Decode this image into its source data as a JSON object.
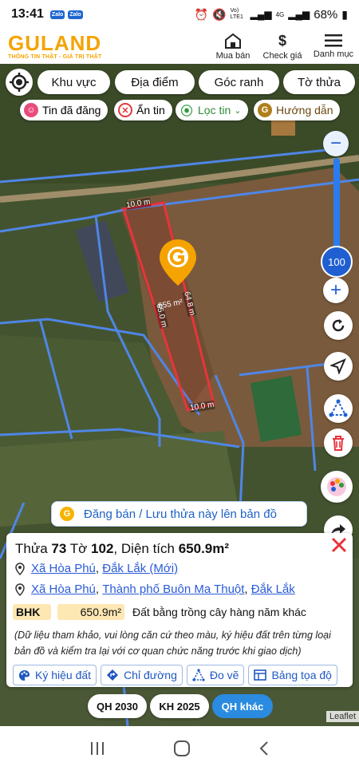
{
  "status": {
    "time": "13:41",
    "apps": [
      "Zalo",
      "Zalo"
    ],
    "network": "Vo) LTE1",
    "signal": "4G",
    "battery": "68%"
  },
  "header": {
    "logo": "GULAND",
    "tagline": "THÔNG TIN THẬT - GIÁ TRỊ THẬT",
    "actions": [
      {
        "label": "Mua bán",
        "icon": "house-icon"
      },
      {
        "label": "Check giá",
        "icon": "dollar-icon"
      },
      {
        "label": "Danh mục",
        "icon": "menu-icon"
      }
    ]
  },
  "filters": {
    "khu_vuc": "Khu vực",
    "dia_diem": "Địa điểm",
    "goc_ranh": "Góc ranh",
    "to_thua": "Tờ thửa"
  },
  "chips": {
    "tin_da_dang": "Tin đã đăng",
    "an_tin": "Ẩn tin",
    "loc_tin": "Lọc tin",
    "huong_dan": "Hướng dẫn"
  },
  "map": {
    "dim_top": "10.0 m",
    "dim_bottom": "10.0 m",
    "dim_right": "64.8 m",
    "dim_left": "65.0 m",
    "area_label": "655 m²",
    "zoom_level": "100",
    "post_button": "Đăng bán / Lưu thửa này lên bản đồ",
    "attribution": "Leaflet"
  },
  "panel": {
    "title_prefix": "Thửa",
    "thua": "73",
    "to_label": "Tờ",
    "to": "102",
    "dien_tich_label": "Diện tích",
    "dien_tich": "650.9m²",
    "addr1": {
      "xa": "Xã Hòa Phú",
      "tinh": "Đắk Lắk (Mới)"
    },
    "addr2": {
      "xa": "Xã Hòa Phú",
      "tp": "Thành phố Buôn Ma Thuột",
      "tinh": "Đắk Lắk"
    },
    "land_code": "BHK",
    "land_area": "650.9m²",
    "land_desc": "Đất bằng trồng cây hàng năm khác",
    "note": "(Dữ liệu tham khảo, vui lòng căn cứ theo màu, ký hiệu đất trên từng loại bản đồ và kiểm tra lại với cơ quan chức năng trước khi giao dịch)",
    "tools": {
      "ky_hieu": "Ký hiệu đất",
      "chi_duong": "Chỉ đường",
      "do_ve": "Đo vẽ",
      "bang_toa_do": "Bảng tọa độ"
    }
  },
  "planning": {
    "qh2030": "QH 2030",
    "kh2025": "KH 2025",
    "qh_khac": "QH khác"
  },
  "colors": {
    "brand": "#f5a300",
    "accent": "#1f63c6",
    "plot_border": "#e8343b",
    "zoom": "#1f5fd1"
  }
}
